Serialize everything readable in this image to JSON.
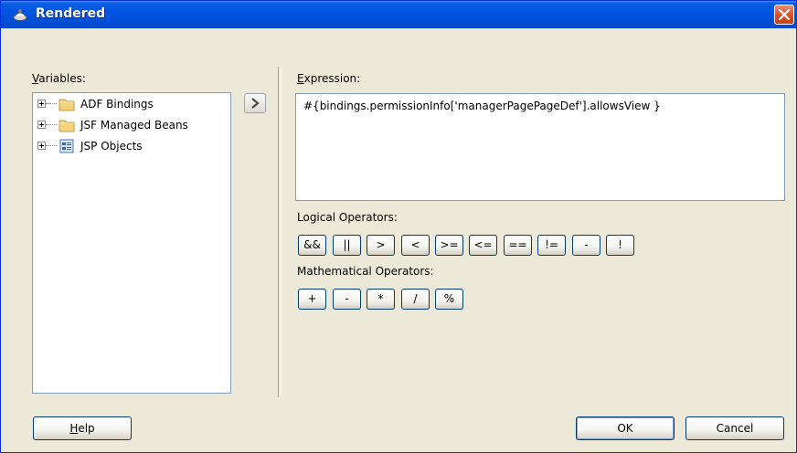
{
  "window": {
    "title": "Rendered",
    "close_icon": "close-icon"
  },
  "variables": {
    "label_mnemonic": "V",
    "label_rest": "ariables:",
    "tree": [
      {
        "label": "ADF Bindings",
        "icon": "folder-icon"
      },
      {
        "label": "JSF Managed Beans",
        "icon": "folder-icon"
      },
      {
        "label": "JSP Objects",
        "icon": "jsp-objects-icon"
      }
    ],
    "insert_icon": "chevron-right-icon"
  },
  "expression": {
    "label_mnemonic": "E",
    "label_rest": "xpression:",
    "value": "#{bindings.permissionInfo['managerPagePageDef'].allowsView }"
  },
  "logical_operators": {
    "label": "Logical Operators:",
    "buttons": [
      "&&",
      "||",
      ">",
      "<",
      ">=",
      "<=",
      "==",
      "!=",
      "-",
      "!"
    ]
  },
  "math_operators": {
    "label": "Mathematical Operators:",
    "buttons": [
      "+",
      "-",
      "*",
      "/",
      "%"
    ]
  },
  "footer": {
    "help_mnemonic": "H",
    "help_rest": "elp",
    "ok_label": "OK",
    "cancel_label": "Cancel"
  },
  "colors": {
    "titlebar": "#0054e3",
    "face": "#ece9d8",
    "border": "#7f9db9"
  }
}
